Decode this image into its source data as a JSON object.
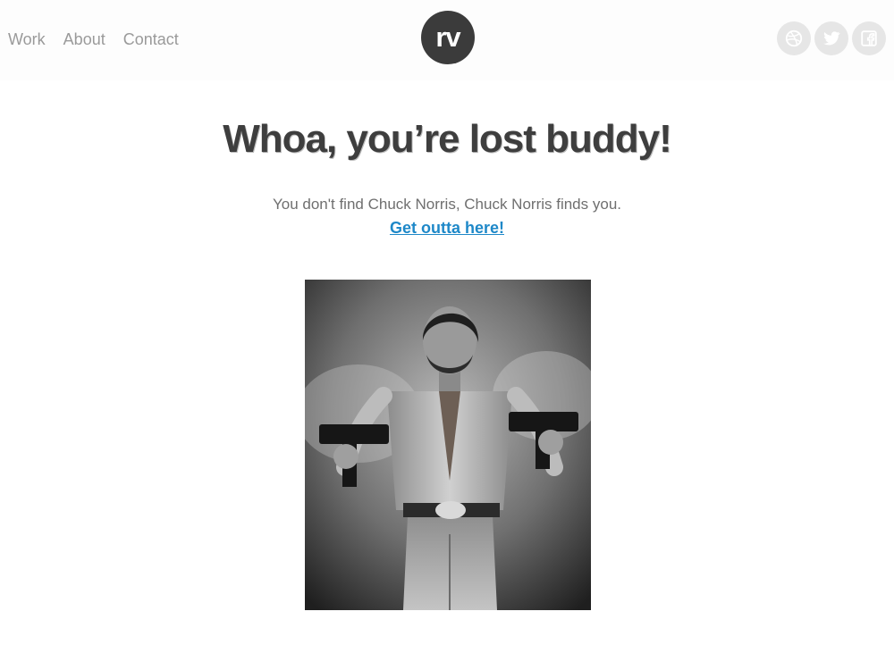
{
  "nav": {
    "items": [
      {
        "label": "Work"
      },
      {
        "label": "About"
      },
      {
        "label": "Contact"
      }
    ]
  },
  "logo": {
    "text": "rv"
  },
  "social": {
    "icons": [
      "dribbble-icon",
      "twitter-icon",
      "facebook-icon"
    ]
  },
  "main": {
    "headline": "Whoa, you’re lost buddy!",
    "subtitle": "You don't find Chuck Norris, Chuck Norris finds you.",
    "cta": "Get outta here!"
  },
  "colors": {
    "headline": "#3e3e3e",
    "link": "#1e88c8",
    "nav": "#9a9a9a",
    "logo_bg": "#3b3b3b",
    "social_bg": "#e6e6e6"
  }
}
